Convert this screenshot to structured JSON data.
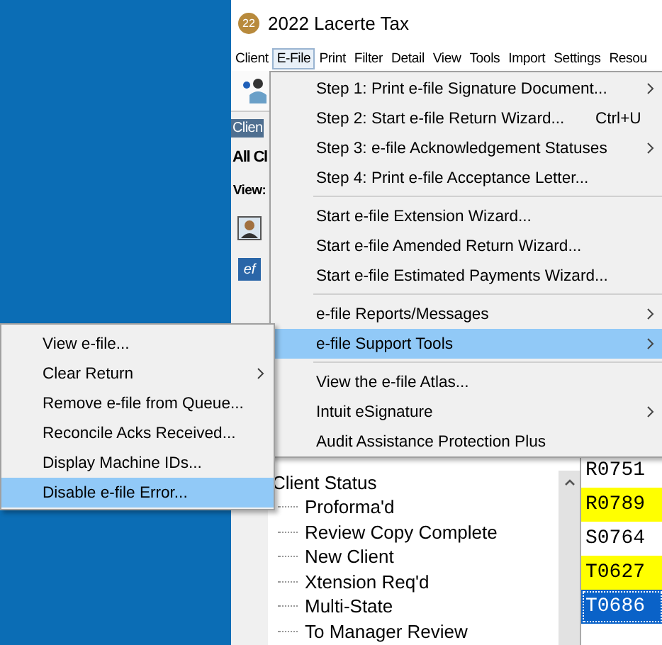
{
  "window": {
    "title": "2022 Lacerte Tax",
    "badge": "22"
  },
  "menubar": [
    {
      "label": "Client",
      "selected": false
    },
    {
      "label": "E-File",
      "selected": true
    },
    {
      "label": "Print",
      "selected": false
    },
    {
      "label": "Filter",
      "selected": false
    },
    {
      "label": "Detail",
      "selected": false
    },
    {
      "label": "View",
      "selected": false
    },
    {
      "label": "Tools",
      "selected": false
    },
    {
      "label": "Import",
      "selected": false
    },
    {
      "label": "Settings",
      "selected": false
    },
    {
      "label": "Resou",
      "selected": false
    }
  ],
  "side": {
    "tab": "Clien",
    "heading": "All Cl",
    "view_label": "View:",
    "ef_icon": "ef"
  },
  "efile_menu": [
    [
      {
        "label": "Step 1: Print e-file Signature Document...",
        "submenu": true,
        "selected": false
      },
      {
        "label": "Step 2: Start e-file Return Wizard...",
        "shortcut": "Ctrl+U",
        "submenu": false,
        "selected": false
      },
      {
        "label": "Step 3: e-file Acknowledgement Statuses",
        "submenu": true,
        "selected": false
      },
      {
        "label": "Step 4: Print e-file Acceptance Letter...",
        "submenu": false,
        "selected": false
      }
    ],
    [
      {
        "label": "Start e-file Extension Wizard...",
        "submenu": false,
        "selected": false
      },
      {
        "label": "Start e-file Amended Return Wizard...",
        "submenu": false,
        "selected": false
      },
      {
        "label": "Start e-file Estimated Payments Wizard...",
        "submenu": false,
        "selected": false
      }
    ],
    [
      {
        "label": "e-file Reports/Messages",
        "submenu": true,
        "selected": false
      },
      {
        "label": "e-file Support Tools",
        "submenu": true,
        "selected": true
      }
    ],
    [
      {
        "label": "View the e-file Atlas...",
        "submenu": false,
        "selected": false
      },
      {
        "label": "Intuit eSignature",
        "submenu": true,
        "selected": false
      },
      {
        "label": "Audit Assistance Protection Plus",
        "submenu": false,
        "selected": false
      }
    ]
  ],
  "support_tools_menu": [
    {
      "label": "View e-file...",
      "submenu": false,
      "selected": false
    },
    {
      "label": "Clear Return",
      "submenu": true,
      "selected": false
    },
    {
      "label": "Remove e-file from Queue...",
      "submenu": false,
      "selected": false
    },
    {
      "label": "Reconcile Acks Received...",
      "submenu": false,
      "selected": false
    },
    {
      "label": "Display Machine IDs...",
      "submenu": false,
      "selected": false
    },
    {
      "label": "Disable e-file Error...",
      "submenu": false,
      "selected": true
    }
  ],
  "tree": [
    {
      "label": "Client Status",
      "children": [
        {
          "label": "Proforma'd"
        },
        {
          "label": "Review Copy Complete"
        },
        {
          "label": "New Client"
        },
        {
          "label": "Xtension Req'd"
        },
        {
          "label": "Multi-State"
        },
        {
          "label": "To Manager Review"
        }
      ]
    }
  ],
  "codes": [
    {
      "code": "R0751",
      "color": "#ffffff",
      "selected": false
    },
    {
      "code": "R0789",
      "color": "#ffff00",
      "selected": false
    },
    {
      "code": "S0764",
      "color": "#ffffff",
      "selected": false
    },
    {
      "code": "T0627",
      "color": "#ffff00",
      "selected": false
    },
    {
      "code": "T0686",
      "selected": true
    }
  ]
}
